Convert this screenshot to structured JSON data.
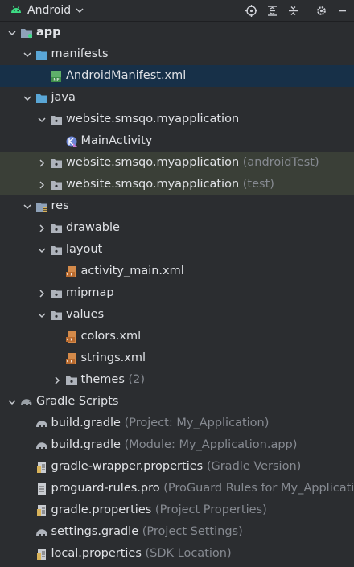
{
  "toolbar": {
    "title": "Android",
    "buttons": [
      "locate-icon",
      "collapse-all-icon",
      "expand-all-icon",
      "gear-icon",
      "minimize-icon"
    ]
  },
  "tree": [
    {
      "label": "app",
      "extra": "",
      "icon": "module-folder-icon",
      "depth": 0,
      "chevron": "down",
      "bold": true
    },
    {
      "label": "manifests",
      "extra": "",
      "icon": "folder-icon",
      "depth": 1,
      "chevron": "down"
    },
    {
      "label": "AndroidManifest.xml",
      "extra": "",
      "icon": "manifest-file-icon",
      "depth": 2,
      "chevron": "",
      "state": "selected"
    },
    {
      "label": "java",
      "extra": "",
      "icon": "folder-icon",
      "depth": 1,
      "chevron": "down"
    },
    {
      "label": "website.smsqo.myapplication",
      "extra": "",
      "icon": "package-icon",
      "depth": 2,
      "chevron": "down"
    },
    {
      "label": "MainActivity",
      "extra": "",
      "icon": "kotlin-class-icon",
      "depth": 3,
      "chevron": ""
    },
    {
      "label": "website.smsqo.myapplication",
      "extra": "(androidTest)",
      "icon": "package-icon",
      "depth": 2,
      "chevron": "right",
      "state": "test"
    },
    {
      "label": "website.smsqo.myapplication",
      "extra": "(test)",
      "icon": "package-icon",
      "depth": 2,
      "chevron": "right",
      "state": "test"
    },
    {
      "label": "res",
      "extra": "",
      "icon": "res-folder-icon",
      "depth": 1,
      "chevron": "down"
    },
    {
      "label": "drawable",
      "extra": "",
      "icon": "package-icon",
      "depth": 2,
      "chevron": "right"
    },
    {
      "label": "layout",
      "extra": "",
      "icon": "package-icon",
      "depth": 2,
      "chevron": "down"
    },
    {
      "label": "activity_main.xml",
      "extra": "",
      "icon": "xml-file-icon",
      "depth": 3,
      "chevron": ""
    },
    {
      "label": "mipmap",
      "extra": "",
      "icon": "package-icon",
      "depth": 2,
      "chevron": "right"
    },
    {
      "label": "values",
      "extra": "",
      "icon": "package-icon",
      "depth": 2,
      "chevron": "down"
    },
    {
      "label": "colors.xml",
      "extra": "",
      "icon": "xml-file-icon",
      "depth": 3,
      "chevron": ""
    },
    {
      "label": "strings.xml",
      "extra": "",
      "icon": "xml-file-icon",
      "depth": 3,
      "chevron": ""
    },
    {
      "label": "themes",
      "extra": "(2)",
      "icon": "package-icon",
      "depth": 3,
      "chevron": "right"
    },
    {
      "label": "Gradle Scripts",
      "extra": "",
      "icon": "gradle-elephant-icon",
      "depth": 0,
      "chevron": "down"
    },
    {
      "label": "build.gradle",
      "extra": "(Project: My_Application)",
      "icon": "gradle-file-icon",
      "depth": 1,
      "chevron": ""
    },
    {
      "label": "build.gradle",
      "extra": "(Module: My_Application.app)",
      "icon": "gradle-file-icon",
      "depth": 1,
      "chevron": ""
    },
    {
      "label": "gradle-wrapper.properties",
      "extra": "(Gradle Version)",
      "icon": "properties-file-icon",
      "depth": 1,
      "chevron": ""
    },
    {
      "label": "proguard-rules.pro",
      "extra": "(ProGuard Rules for My_Application",
      "icon": "text-file-icon",
      "depth": 1,
      "chevron": ""
    },
    {
      "label": "gradle.properties",
      "extra": "(Project Properties)",
      "icon": "properties-file-icon",
      "depth": 1,
      "chevron": ""
    },
    {
      "label": "settings.gradle",
      "extra": "(Project Settings)",
      "icon": "gradle-file-icon",
      "depth": 1,
      "chevron": ""
    },
    {
      "label": "local.properties",
      "extra": "(SDK Location)",
      "icon": "properties-file-icon",
      "depth": 1,
      "chevron": ""
    }
  ]
}
